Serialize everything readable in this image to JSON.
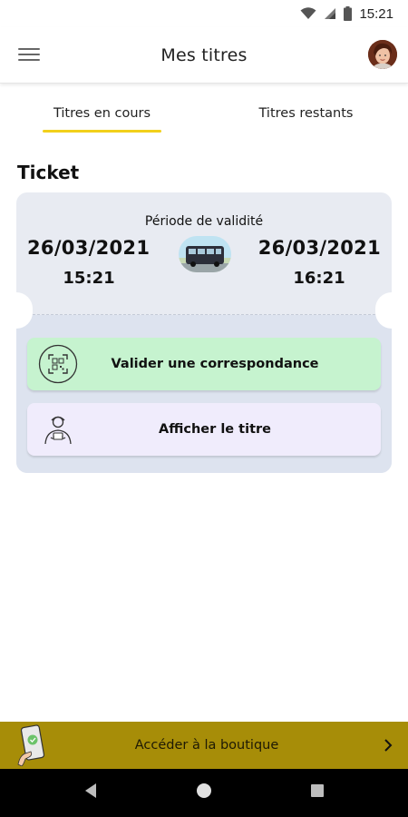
{
  "status_bar": {
    "time": "15:21",
    "icons": [
      "wifi-icon",
      "signal-icon",
      "battery-icon"
    ]
  },
  "header": {
    "title": "Mes titres",
    "menu_icon": "hamburger-menu-icon",
    "avatar": "user-avatar"
  },
  "tabs": [
    {
      "label": "Titres en cours",
      "active": true
    },
    {
      "label": "Titres restants",
      "active": false
    }
  ],
  "section_title": "Ticket",
  "ticket": {
    "validity_label": "Période de validité",
    "start_date": "26/03/2021",
    "start_time": "15:21",
    "end_date": "26/03/2021",
    "end_time": "16:21",
    "image": "bus-icon",
    "actions": [
      {
        "label": "Valider une correspondance",
        "icon": "qr-scan-icon",
        "color": "#c6f3cf"
      },
      {
        "label": "Afficher le titre",
        "icon": "inspector-icon",
        "color": "#f0ecfc"
      }
    ]
  },
  "boutique": {
    "label": "Accéder à la boutique",
    "icon": "phone-ticket-icon",
    "chevron": "chevron-right-icon",
    "color": "#a78d08"
  },
  "nav": [
    "back-icon",
    "home-icon",
    "recents-icon"
  ],
  "colors": {
    "accent": "#f2d01b",
    "ticket_bg": "#e8ebf2"
  }
}
